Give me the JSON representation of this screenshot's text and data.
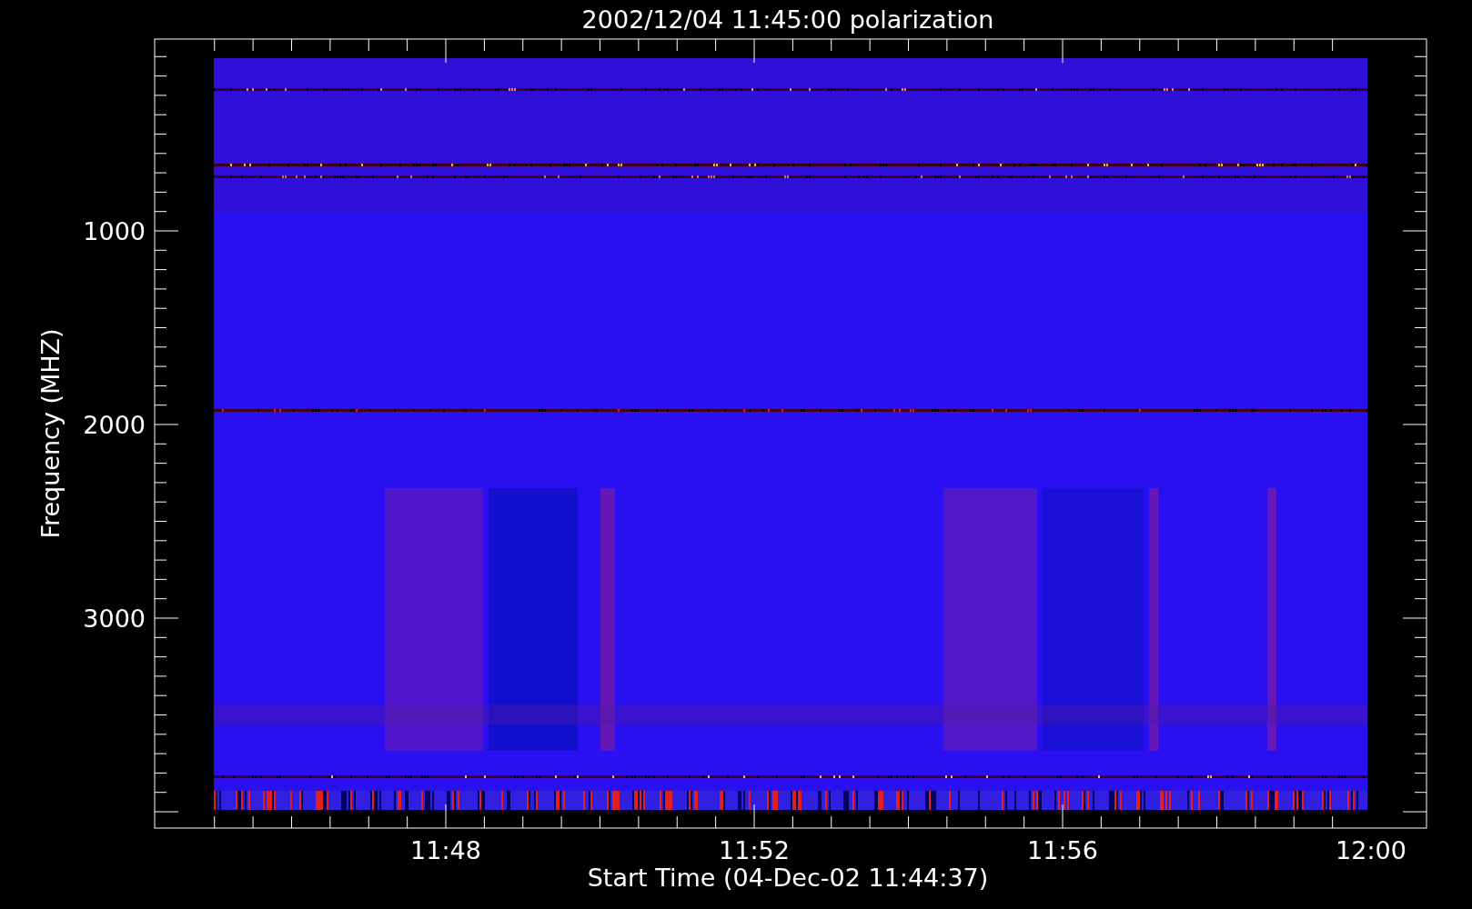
{
  "plot": {
    "title": "2002/12/04 11:45:00 polarization",
    "ylabel": "Frequency (MHZ)",
    "xlabel": "Start Time (04-Dec-02 11:44:37)",
    "yticks": [
      "1000",
      "2000",
      "3000"
    ],
    "xticks": [
      "11:48",
      "11:52",
      "11:56",
      "12:00"
    ]
  }
}
